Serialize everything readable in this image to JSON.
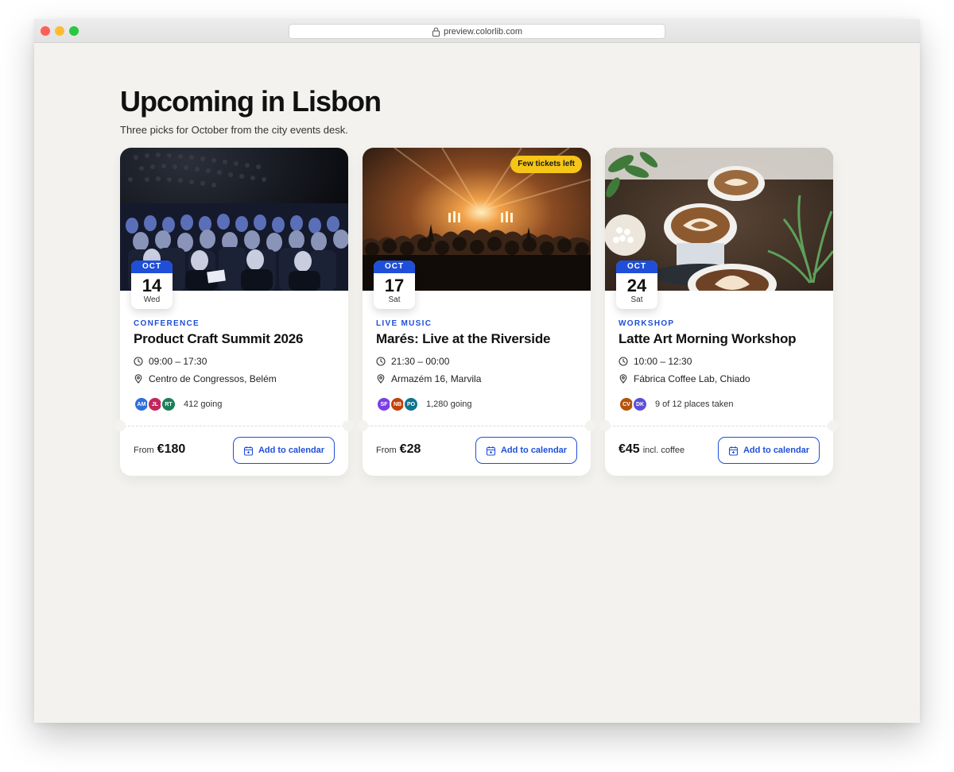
{
  "browser": {
    "url": "preview.colorlib.com"
  },
  "page": {
    "title": "Upcoming in Lisbon",
    "subtitle": "Three picks for October from the city events desk."
  },
  "cards": [
    {
      "category": "CONFERENCE",
      "title": "Product Craft Summit 2026",
      "month": "OCT",
      "day": "14",
      "weekday": "Wed",
      "time": "09:00  –  17:30",
      "location": "Centro de Congressos, Belém",
      "avatars": [
        {
          "initials": "AM",
          "color": "#2f6fde"
        },
        {
          "initials": "JL",
          "color": "#c2255c"
        },
        {
          "initials": "RT",
          "color": "#1b7f5a"
        }
      ],
      "going": "412 going",
      "price_prefix": "From",
      "price": "€180",
      "price_suffix": "",
      "button_label": "Add to calendar",
      "badge": ""
    },
    {
      "category": "LIVE MUSIC",
      "title": "Marés: Live at the Riverside",
      "month": "OCT",
      "day": "17",
      "weekday": "Sat",
      "time": "21:30  –  00:00",
      "location": "Armazém 16, Marvila",
      "avatars": [
        {
          "initials": "SF",
          "color": "#7b3fe4"
        },
        {
          "initials": "NB",
          "color": "#c2410c"
        },
        {
          "initials": "PO",
          "color": "#0e7490"
        }
      ],
      "going": "1,280 going",
      "price_prefix": "From",
      "price": "€28",
      "price_suffix": "",
      "button_label": "Add to calendar",
      "badge": "Few tickets left"
    },
    {
      "category": "WORKSHOP",
      "title": "Latte Art Morning Workshop",
      "month": "OCT",
      "day": "24",
      "weekday": "Sat",
      "time": "10:00  –  12:30",
      "location": "Fábrica Coffee Lab, Chiado",
      "avatars": [
        {
          "initials": "CV",
          "color": "#b45309"
        },
        {
          "initials": "DK",
          "color": "#5b4fd6"
        }
      ],
      "going": "9 of 12 places taken",
      "price_prefix": "",
      "price": "€45",
      "price_suffix": "incl. coffee",
      "button_label": "Add to calendar",
      "badge": ""
    }
  ],
  "colors": {
    "accent": "#1f4fd8",
    "badge": "#f5c518",
    "background": "#f3f2ee"
  },
  "icons": [
    "lock-icon",
    "clock-icon",
    "map-pin-icon",
    "calendar-icon"
  ]
}
